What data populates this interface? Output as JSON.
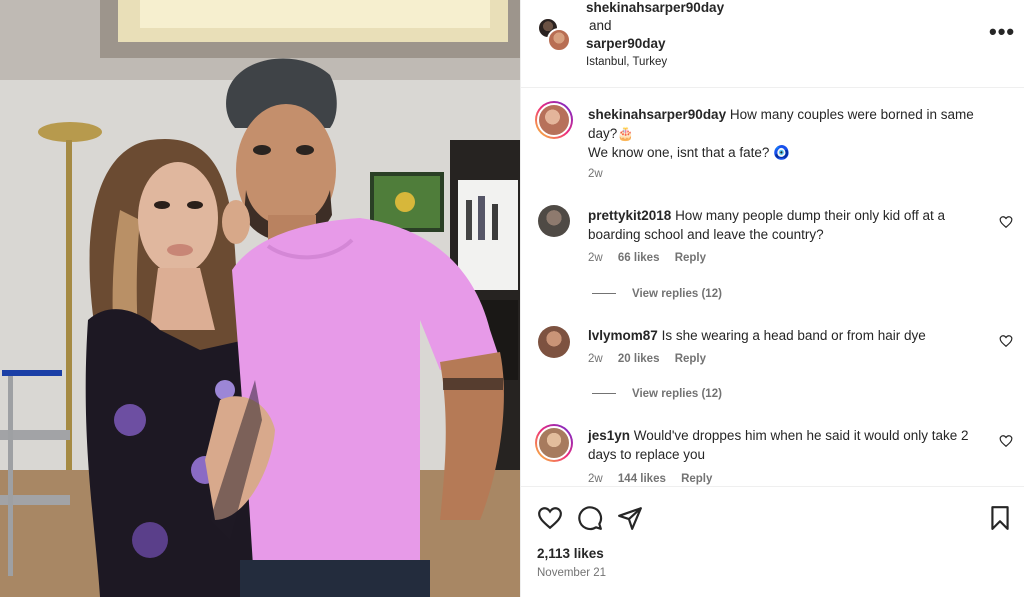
{
  "colors": {
    "accent_link": "#00376b",
    "muted": "#737373",
    "text": "#262626",
    "shirt": "#e79ae8"
  },
  "header": {
    "user1": "shekinahsarper90day",
    "joiner": "and",
    "user2": "sarper90day",
    "location": "Istanbul, Turkey",
    "more_icon": "more-horizontal-icon"
  },
  "caption": {
    "username": "shekinahsarper90day",
    "text_line1": "How many couples were borned in same day?🎂",
    "text_line2": "We know one, isnt that a fate? 🧿",
    "time": "2w"
  },
  "comments": [
    {
      "username": "prettykit2018",
      "text": "How many people dump their only kid off at a boarding school and leave the country?",
      "time": "2w",
      "likes": "66 likes",
      "reply": "Reply",
      "view_replies": "View replies (12)"
    },
    {
      "username": "lvlymom87",
      "text": "Is she wearing a head band or from hair dye",
      "time": "2w",
      "likes": "20 likes",
      "reply": "Reply",
      "view_replies": "View replies (12)"
    },
    {
      "username": "jes1yn",
      "text": "Would've droppes him when he said it would only take 2 days to replace you",
      "time": "2w",
      "likes": "144 likes",
      "reply": "Reply"
    }
  ],
  "actions": {
    "likes_count": "2,113 likes",
    "date": "November 21"
  }
}
